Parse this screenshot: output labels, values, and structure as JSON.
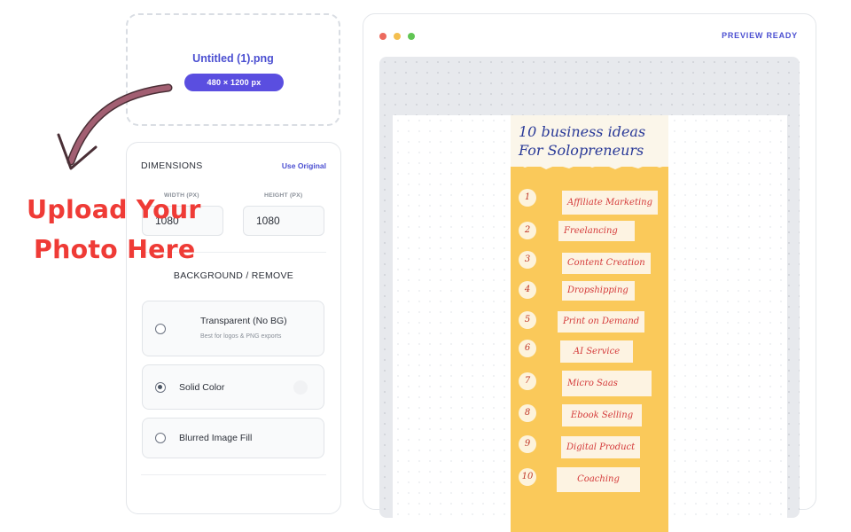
{
  "upload": {
    "file_name": "Untitled (1).png",
    "dimensions_pill": "480 × 1200   px"
  },
  "dimensions": {
    "title": "DIMENSIONS",
    "use_original": "Use Original",
    "width_label": "WIDTH (PX)",
    "width_value": "1080",
    "height_label": "HEIGHT (PX)",
    "height_value": "1080"
  },
  "background": {
    "title": "BACKGROUND / REMOVE",
    "options": [
      {
        "title": "Transparent (No BG)",
        "subtitle": "Best for logos & PNG exports",
        "selected": false
      },
      {
        "title": "Solid Color",
        "subtitle": "",
        "selected": true
      },
      {
        "title": "Blurred Image Fill",
        "subtitle": "",
        "selected": false
      }
    ]
  },
  "annotation": {
    "line1": "Upload Your",
    "line2": "Photo Here",
    "color": "#ef3b36"
  },
  "preview": {
    "status": "PREVIEW READY",
    "window_dots": [
      "#ec6a5e",
      "#f4bf4f",
      "#61c554"
    ]
  },
  "infographic": {
    "title_line1": "10 business ideas",
    "title_line2": "For Solopreneurs",
    "items": [
      {
        "num": "1",
        "label": "Affiliate Marketing"
      },
      {
        "num": "2",
        "label": "Freelancing"
      },
      {
        "num": "3",
        "label": "Content Creation"
      },
      {
        "num": "4",
        "label": "Dropshipping"
      },
      {
        "num": "5",
        "label": "Print on Demand"
      },
      {
        "num": "6",
        "label": "AI Service"
      },
      {
        "num": "7",
        "label": "Micro Saas"
      },
      {
        "num": "8",
        "label": "Ebook Selling"
      },
      {
        "num": "9",
        "label": "Digital Product"
      },
      {
        "num": "10",
        "label": "Coaching"
      }
    ]
  },
  "colors": {
    "accent": "#4b4fd1",
    "pill": "#5a4ee0",
    "infographic_bg": "#fac95a",
    "arrow": "#a25f72"
  }
}
